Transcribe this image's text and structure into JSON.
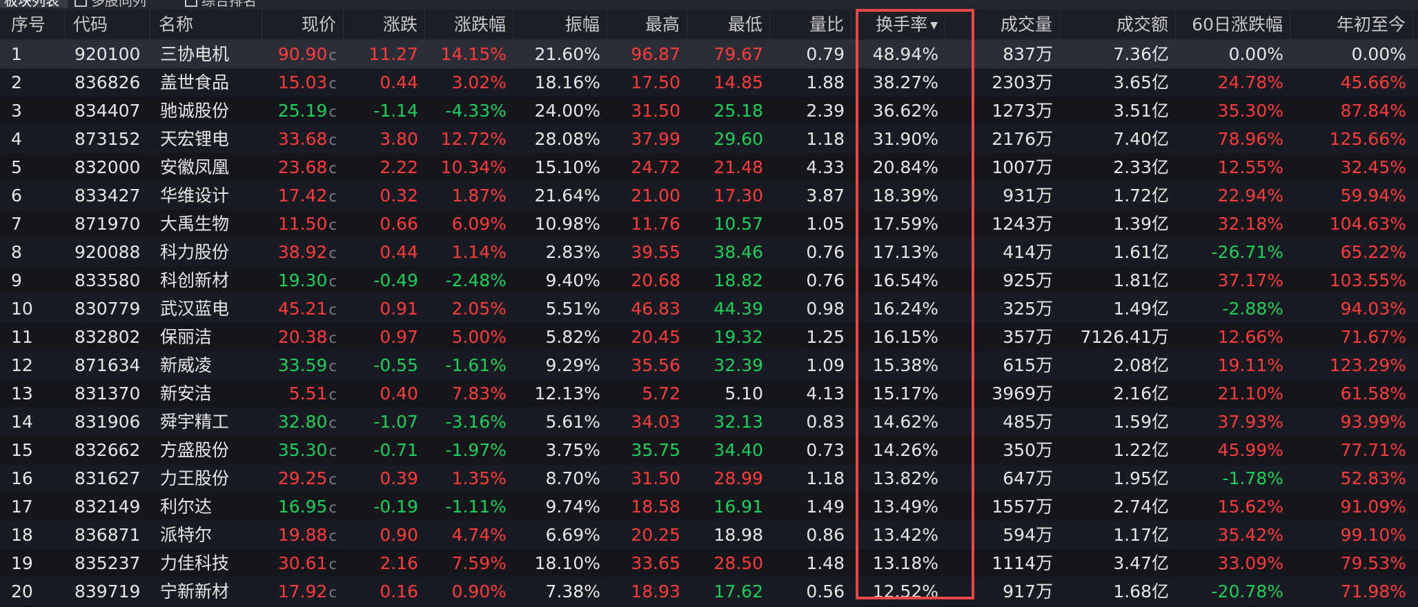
{
  "tabs": [
    "板块列表",
    "多股同列",
    "综合排名"
  ],
  "columns": [
    "序号",
    "代码",
    "名称",
    "现价",
    "涨跌",
    "涨跌幅",
    "振幅",
    "最高",
    "最低",
    "量比",
    "换手率",
    "成交量",
    "成交额",
    "60日涨跌幅",
    "年初至今"
  ],
  "sorted_column": "换手率",
  "price_flag": "c",
  "colors": {
    "up": "#ff3b3b",
    "down": "#19d15a",
    "highlight_border": "#e8474a",
    "background": "#14161c"
  },
  "rows": [
    {
      "idx": "1",
      "code": "920100",
      "name": "三协电机",
      "price": "90.90",
      "chg": "11.27",
      "pct": "14.15%",
      "amp": "21.60%",
      "high": "96.87",
      "low": "79.67",
      "vr": "0.79",
      "tr": "48.94%",
      "vol": "837万",
      "amt": "7.36亿",
      "d60": "0.00%",
      "ytd": "0.00%",
      "dir": "up",
      "hd": "up",
      "ld": "up",
      "d60d": "flat",
      "ytdd": "flat"
    },
    {
      "idx": "2",
      "code": "836826",
      "name": "盖世食品",
      "price": "15.03",
      "chg": "0.44",
      "pct": "3.02%",
      "amp": "18.16%",
      "high": "17.50",
      "low": "14.85",
      "vr": "1.88",
      "tr": "38.27%",
      "vol": "2303万",
      "amt": "3.65亿",
      "d60": "24.78%",
      "ytd": "45.66%",
      "dir": "up",
      "hd": "up",
      "ld": "up",
      "d60d": "up",
      "ytdd": "up"
    },
    {
      "idx": "3",
      "code": "834407",
      "name": "驰诚股份",
      "price": "25.19",
      "chg": "-1.14",
      "pct": "-4.33%",
      "amp": "24.00%",
      "high": "31.50",
      "low": "25.18",
      "vr": "2.39",
      "tr": "36.62%",
      "vol": "1273万",
      "amt": "3.51亿",
      "d60": "35.30%",
      "ytd": "87.84%",
      "dir": "down",
      "hd": "up",
      "ld": "down",
      "d60d": "up",
      "ytdd": "up"
    },
    {
      "idx": "4",
      "code": "873152",
      "name": "天宏锂电",
      "price": "33.68",
      "chg": "3.80",
      "pct": "12.72%",
      "amp": "28.08%",
      "high": "37.99",
      "low": "29.60",
      "vr": "1.18",
      "tr": "31.90%",
      "vol": "2176万",
      "amt": "7.40亿",
      "d60": "78.96%",
      "ytd": "125.66%",
      "dir": "up",
      "hd": "up",
      "ld": "down",
      "d60d": "up",
      "ytdd": "up"
    },
    {
      "idx": "5",
      "code": "832000",
      "name": "安徽凤凰",
      "price": "23.68",
      "chg": "2.22",
      "pct": "10.34%",
      "amp": "15.10%",
      "high": "24.72",
      "low": "21.48",
      "vr": "4.33",
      "tr": "20.84%",
      "vol": "1007万",
      "amt": "2.33亿",
      "d60": "12.55%",
      "ytd": "32.45%",
      "dir": "up",
      "hd": "up",
      "ld": "up",
      "d60d": "up",
      "ytdd": "up"
    },
    {
      "idx": "6",
      "code": "833427",
      "name": "华维设计",
      "price": "17.42",
      "chg": "0.32",
      "pct": "1.87%",
      "amp": "21.64%",
      "high": "21.00",
      "low": "17.30",
      "vr": "3.87",
      "tr": "18.39%",
      "vol": "931万",
      "amt": "1.72亿",
      "d60": "22.94%",
      "ytd": "59.94%",
      "dir": "up",
      "hd": "up",
      "ld": "up",
      "d60d": "up",
      "ytdd": "up"
    },
    {
      "idx": "7",
      "code": "871970",
      "name": "大禹生物",
      "price": "11.50",
      "chg": "0.66",
      "pct": "6.09%",
      "amp": "10.98%",
      "high": "11.76",
      "low": "10.57",
      "vr": "1.05",
      "tr": "17.59%",
      "vol": "1243万",
      "amt": "1.39亿",
      "d60": "32.18%",
      "ytd": "104.63%",
      "dir": "up",
      "hd": "up",
      "ld": "down",
      "d60d": "up",
      "ytdd": "up"
    },
    {
      "idx": "8",
      "code": "920088",
      "name": "科力股份",
      "price": "38.92",
      "chg": "0.44",
      "pct": "1.14%",
      "amp": "2.83%",
      "high": "39.55",
      "low": "38.46",
      "vr": "0.76",
      "tr": "17.13%",
      "vol": "414万",
      "amt": "1.61亿",
      "d60": "-26.71%",
      "ytd": "65.22%",
      "dir": "up",
      "hd": "up",
      "ld": "down",
      "d60d": "down",
      "ytdd": "up"
    },
    {
      "idx": "9",
      "code": "833580",
      "name": "科创新材",
      "price": "19.30",
      "chg": "-0.49",
      "pct": "-2.48%",
      "amp": "9.40%",
      "high": "20.68",
      "low": "18.82",
      "vr": "0.76",
      "tr": "16.54%",
      "vol": "925万",
      "amt": "1.81亿",
      "d60": "37.17%",
      "ytd": "103.55%",
      "dir": "down",
      "hd": "up",
      "ld": "down",
      "d60d": "up",
      "ytdd": "up"
    },
    {
      "idx": "10",
      "code": "830779",
      "name": "武汉蓝电",
      "price": "45.21",
      "chg": "0.91",
      "pct": "2.05%",
      "amp": "5.51%",
      "high": "46.83",
      "low": "44.39",
      "vr": "0.98",
      "tr": "16.24%",
      "vol": "325万",
      "amt": "1.49亿",
      "d60": "-2.88%",
      "ytd": "94.03%",
      "dir": "up",
      "hd": "up",
      "ld": "down",
      "d60d": "down",
      "ytdd": "up"
    },
    {
      "idx": "11",
      "code": "832802",
      "name": "保丽洁",
      "price": "20.38",
      "chg": "0.97",
      "pct": "5.00%",
      "amp": "5.82%",
      "high": "20.45",
      "low": "19.32",
      "vr": "1.25",
      "tr": "16.15%",
      "vol": "357万",
      "amt": "7126.41万",
      "d60": "12.66%",
      "ytd": "71.67%",
      "dir": "up",
      "hd": "up",
      "ld": "down",
      "d60d": "up",
      "ytdd": "up"
    },
    {
      "idx": "12",
      "code": "871634",
      "name": "新威凌",
      "price": "33.59",
      "chg": "-0.55",
      "pct": "-1.61%",
      "amp": "9.29%",
      "high": "35.56",
      "low": "32.39",
      "vr": "1.09",
      "tr": "15.38%",
      "vol": "615万",
      "amt": "2.08亿",
      "d60": "19.11%",
      "ytd": "123.29%",
      "dir": "down",
      "hd": "up",
      "ld": "down",
      "d60d": "up",
      "ytdd": "up"
    },
    {
      "idx": "13",
      "code": "831370",
      "name": "新安洁",
      "price": "5.51",
      "chg": "0.40",
      "pct": "7.83%",
      "amp": "12.13%",
      "high": "5.72",
      "low": "5.10",
      "vr": "4.13",
      "tr": "15.17%",
      "vol": "3969万",
      "amt": "2.16亿",
      "d60": "21.10%",
      "ytd": "61.58%",
      "dir": "up",
      "hd": "up",
      "ld": "flat",
      "d60d": "up",
      "ytdd": "up"
    },
    {
      "idx": "14",
      "code": "831906",
      "name": "舜宇精工",
      "price": "32.80",
      "chg": "-1.07",
      "pct": "-3.16%",
      "amp": "5.61%",
      "high": "34.03",
      "low": "32.13",
      "vr": "0.83",
      "tr": "14.62%",
      "vol": "485万",
      "amt": "1.59亿",
      "d60": "37.93%",
      "ytd": "93.99%",
      "dir": "down",
      "hd": "up",
      "ld": "down",
      "d60d": "up",
      "ytdd": "up"
    },
    {
      "idx": "15",
      "code": "832662",
      "name": "方盛股份",
      "price": "35.30",
      "chg": "-0.71",
      "pct": "-1.97%",
      "amp": "3.75%",
      "high": "35.75",
      "low": "34.40",
      "vr": "0.73",
      "tr": "14.26%",
      "vol": "350万",
      "amt": "1.22亿",
      "d60": "45.99%",
      "ytd": "77.71%",
      "dir": "down",
      "hd": "down",
      "ld": "down",
      "d60d": "up",
      "ytdd": "up"
    },
    {
      "idx": "16",
      "code": "831627",
      "name": "力王股份",
      "price": "29.25",
      "chg": "0.39",
      "pct": "1.35%",
      "amp": "8.70%",
      "high": "31.50",
      "low": "28.99",
      "vr": "1.18",
      "tr": "13.82%",
      "vol": "647万",
      "amt": "1.95亿",
      "d60": "-1.78%",
      "ytd": "52.83%",
      "dir": "up",
      "hd": "up",
      "ld": "up",
      "d60d": "down",
      "ytdd": "up"
    },
    {
      "idx": "17",
      "code": "832149",
      "name": "利尔达",
      "price": "16.95",
      "chg": "-0.19",
      "pct": "-1.11%",
      "amp": "9.74%",
      "high": "18.58",
      "low": "16.91",
      "vr": "1.49",
      "tr": "13.49%",
      "vol": "1557万",
      "amt": "2.74亿",
      "d60": "15.62%",
      "ytd": "91.09%",
      "dir": "down",
      "hd": "up",
      "ld": "down",
      "d60d": "up",
      "ytdd": "up"
    },
    {
      "idx": "18",
      "code": "836871",
      "name": "派特尔",
      "price": "19.88",
      "chg": "0.90",
      "pct": "4.74%",
      "amp": "6.69%",
      "high": "20.25",
      "low": "18.98",
      "vr": "0.86",
      "tr": "13.42%",
      "vol": "594万",
      "amt": "1.17亿",
      "d60": "35.42%",
      "ytd": "99.10%",
      "dir": "up",
      "hd": "up",
      "ld": "flat",
      "d60d": "up",
      "ytdd": "up"
    },
    {
      "idx": "19",
      "code": "835237",
      "name": "力佳科技",
      "price": "30.61",
      "chg": "2.16",
      "pct": "7.59%",
      "amp": "18.10%",
      "high": "33.65",
      "low": "28.50",
      "vr": "1.48",
      "tr": "13.18%",
      "vol": "1114万",
      "amt": "3.47亿",
      "d60": "33.09%",
      "ytd": "79.53%",
      "dir": "up",
      "hd": "up",
      "ld": "up",
      "d60d": "up",
      "ytdd": "up"
    },
    {
      "idx": "20",
      "code": "839719",
      "name": "宁新新材",
      "price": "17.92",
      "chg": "0.16",
      "pct": "0.90%",
      "amp": "7.38%",
      "high": "18.93",
      "low": "17.62",
      "vr": "0.56",
      "tr": "12.52%",
      "vol": "917万",
      "amt": "1.68亿",
      "d60": "-20.78%",
      "ytd": "71.98%",
      "dir": "up",
      "hd": "up",
      "ld": "down",
      "d60d": "down",
      "ytdd": "up"
    }
  ]
}
